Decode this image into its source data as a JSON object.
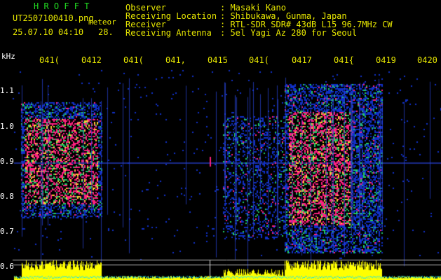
{
  "header": {
    "app_name": "H R O F F T",
    "filename": "UT2507100410.png",
    "meteor_label": "meteor",
    "datetime": "25.07.10 04:10",
    "count": "28.",
    "info": [
      {
        "label": "Observer",
        "value": ": Masaki Kano"
      },
      {
        "label": "Receiving Location",
        "value": ": Shibukawa, Gunma, Japan"
      },
      {
        "label": "Receiver",
        "value": ": RTL-SDR SDR# 43dB L15 96.7MHz CW"
      },
      {
        "label": "Receiving Antenna",
        "value": ": 5el Yagi Az 280 for Seoul"
      }
    ]
  },
  "axis": {
    "unit": "kHz",
    "y_ticks": [
      "1.1",
      "1.0",
      "0.9",
      "0.8",
      "0.7",
      "0.6"
    ],
    "x_ticks": [
      "041(",
      "0412",
      "041(",
      "041,",
      "0415",
      "041(",
      "0417",
      "041{",
      "0419",
      "0420"
    ]
  },
  "colors": {
    "background": "#000000",
    "title_green": "#22dd22",
    "text_yellow": "#e8e800",
    "text_white": "#ffffff",
    "signal_low": "#1030c8",
    "signal_mid": "#22cc66",
    "signal_high": "#ff2080",
    "level_yellow": "#ffff00",
    "level_cyan": "#00e0ff"
  }
}
